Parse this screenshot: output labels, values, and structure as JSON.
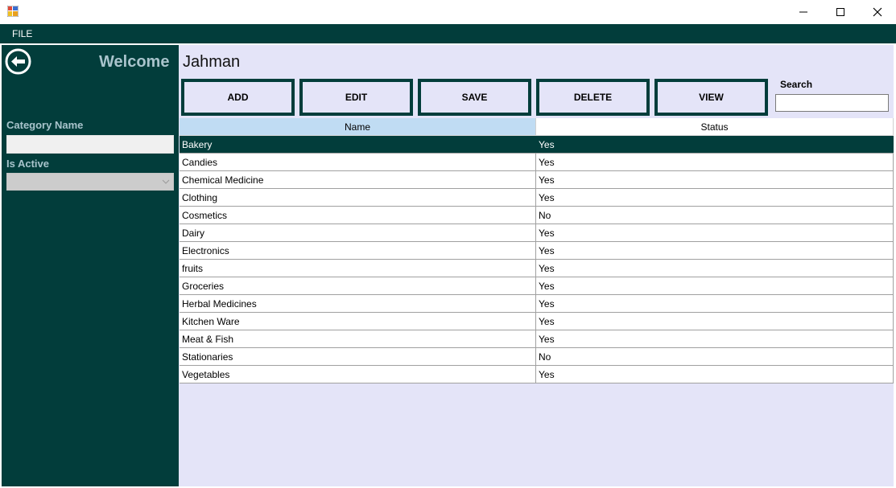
{
  "window": {
    "controls": {
      "minimize": "minimize",
      "maximize": "maximize",
      "close": "close"
    }
  },
  "menu": {
    "items": [
      {
        "label": "FILE"
      }
    ]
  },
  "sidebar": {
    "welcome": "Welcome",
    "category_label": "Category Name",
    "category_value": "",
    "active_label": "Is Active",
    "active_value": ""
  },
  "header": {
    "username": "Jahman"
  },
  "toolbar": {
    "add_label": "ADD",
    "edit_label": "EDIT",
    "save_label": "SAVE",
    "delete_label": "DELETE",
    "view_label": "VIEW"
  },
  "search": {
    "label": "Search",
    "value": ""
  },
  "table": {
    "columns": [
      "Name",
      "Status"
    ],
    "selected_index": 0,
    "rows": [
      {
        "name": "Bakery",
        "status": "Yes"
      },
      {
        "name": "Candies",
        "status": "Yes"
      },
      {
        "name": "Chemical Medicine",
        "status": "Yes"
      },
      {
        "name": "Clothing",
        "status": "Yes"
      },
      {
        "name": "Cosmetics",
        "status": "No"
      },
      {
        "name": "Dairy",
        "status": "Yes"
      },
      {
        "name": "Electronics",
        "status": "Yes"
      },
      {
        "name": "fruits",
        "status": "Yes"
      },
      {
        "name": "Groceries",
        "status": "Yes"
      },
      {
        "name": "Herbal Medicines",
        "status": "Yes"
      },
      {
        "name": "Kitchen Ware",
        "status": "Yes"
      },
      {
        "name": "Meat & Fish",
        "status": "Yes"
      },
      {
        "name": "Stationaries",
        "status": "No"
      },
      {
        "name": "Vegetables",
        "status": "Yes"
      }
    ]
  },
  "colors": {
    "primary": "#023d3b",
    "panel": "#e4e4f8",
    "header_selected": "#c0dcf3",
    "label_text": "#a9c4cc"
  },
  "icons": {
    "app": "app-icon",
    "back": "back-arrow-icon",
    "dropdown": "chevron-down-icon"
  }
}
